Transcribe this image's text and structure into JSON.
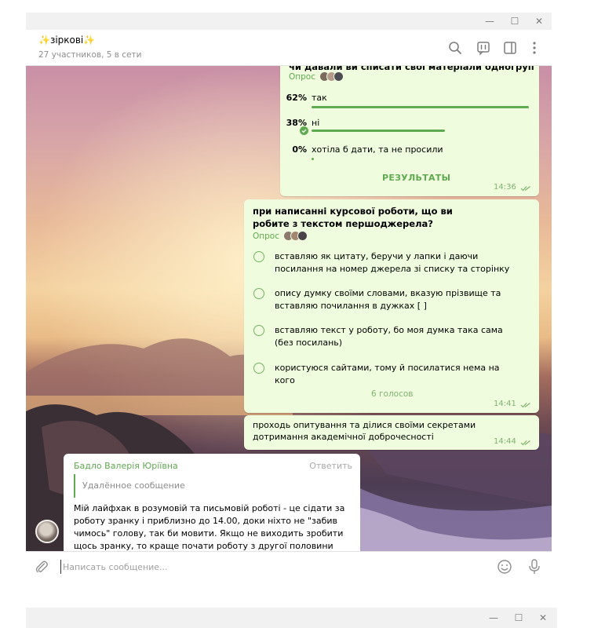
{
  "window": {
    "minimize_glyph": "—",
    "maximize_glyph": "☐",
    "close_glyph": "✕"
  },
  "header": {
    "title": "✨зіркові✨",
    "subtitle": "27 участников, 5 в сети",
    "icons": [
      "search-icon",
      "poll-icon",
      "sidebar-toggle-icon",
      "more-icon"
    ]
  },
  "poll1": {
    "question": "чи давали ви списати свої матеріали одногрупникам?",
    "label": "Опрос",
    "options": [
      {
        "percent": "62%",
        "text": "так",
        "fill": 0.62
      },
      {
        "percent": "38%",
        "text": "ні",
        "fill": 0.38,
        "chosen": true
      },
      {
        "percent": "0%",
        "text": "хотіла б дати, та не просили",
        "fill": 0.0
      }
    ],
    "results_label": "РЕЗУЛЬТАТЫ",
    "time": "14:36"
  },
  "poll2": {
    "question": "при написанні курсової роботи, що ви робите з текстом першоджерела?",
    "label": "Опрос",
    "options": [
      "вставляю як цитату, беручи у лапки і даючи посилання на номер джерела зі списку та сторінку",
      "опису думку своїми словами, вказую прізвище та вставляю почилання в дужках [ ]",
      "вставляю текст у роботу, бо моя думка така сама (без посилань)",
      "користуюся сайтами, тому й посилатися нема на кого"
    ],
    "votes": "6 голосов",
    "time": "14:41"
  },
  "message": {
    "text": "проходь опитування та ділися своїми секретами дотримання академічної доброчесності",
    "time": "14:44"
  },
  "reply_message": {
    "sender": "Бадло Валерія Юріївна",
    "reply_link": "Ответить",
    "quote": "Удалённое сообщение",
    "text": "Мій лайфхак в розумовій та письмовій роботі - це сідати за роботу зранку і приблизно до 14.00, доки ніхто не \"забив чимось\" голову, так би мовити. Якщо не виходить зробити щось зранку, то краще почати роботу з другої половини дня і"
  },
  "composer": {
    "placeholder": "Написать сообщение..."
  },
  "colors": {
    "accent": "#5fa950",
    "bubble": "#effdde",
    "muted": "#8e8e8e"
  }
}
